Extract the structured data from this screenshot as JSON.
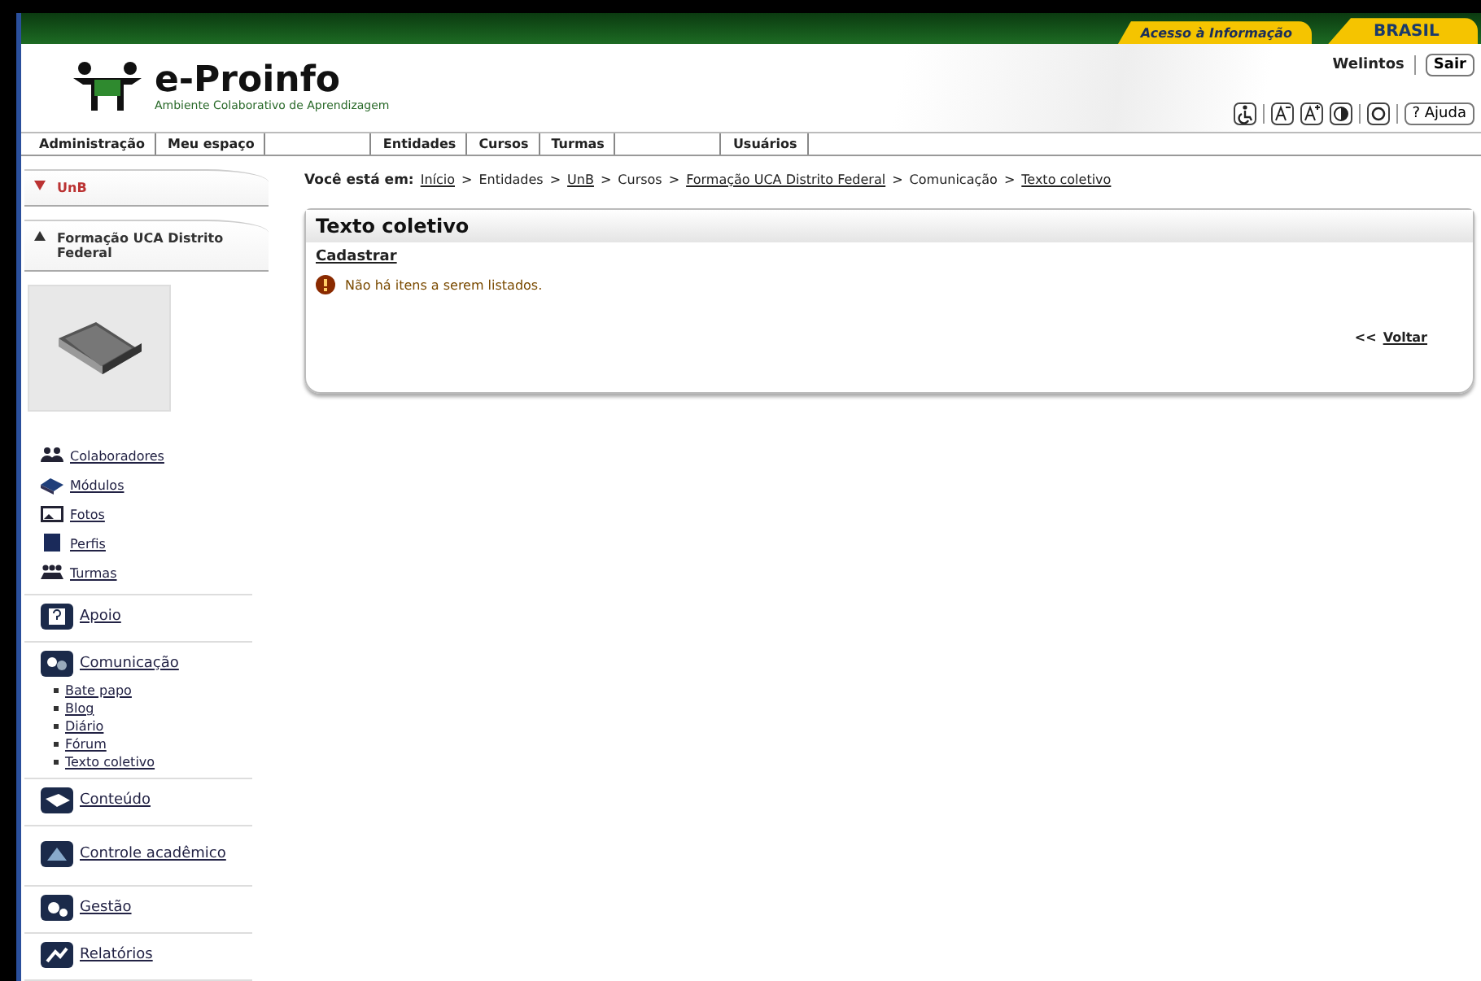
{
  "gov_bar": {
    "info_link": "Acesso à Informação",
    "brand": "BRASIL"
  },
  "header": {
    "logo_title": "e-Proinfo",
    "logo_subtitle": "Ambiente Colaborativo de Aprendizagem",
    "user": "Welintos",
    "logout": "Sair",
    "help": "? Ajuda"
  },
  "tabs": [
    {
      "kind": "tab",
      "label": "Administração"
    },
    {
      "kind": "tab",
      "label": "Meu espaço"
    },
    {
      "kind": "blank"
    },
    {
      "kind": "tab",
      "label": "Entidades"
    },
    {
      "kind": "tab",
      "label": "Cursos"
    },
    {
      "kind": "tab",
      "label": "Turmas"
    },
    {
      "kind": "blank"
    },
    {
      "kind": "tab",
      "label": "Usuários"
    }
  ],
  "sidebar": {
    "sections": [
      {
        "label": "UnB",
        "expanded": false
      },
      {
        "label": "Formação UCA Distrito Federal",
        "expanded": true
      }
    ],
    "groups": [
      {
        "items": [
          {
            "label": "Colaboradores"
          },
          {
            "label": "Módulos"
          },
          {
            "label": "Fotos"
          },
          {
            "label": "Perfis"
          },
          {
            "label": "Turmas"
          }
        ]
      },
      {
        "items": [
          {
            "label": "Apoio"
          }
        ]
      },
      {
        "items": [
          {
            "label": "Comunicação",
            "children": [
              {
                "label": "Bate papo"
              },
              {
                "label": "Blog"
              },
              {
                "label": "Diário"
              },
              {
                "label": "Fórum"
              },
              {
                "label": "Texto coletivo"
              }
            ]
          }
        ]
      },
      {
        "items": [
          {
            "label": "Conteúdo"
          }
        ]
      },
      {
        "items": [
          {
            "label": "Controle acadêmico"
          }
        ]
      },
      {
        "items": [
          {
            "label": "Gestão"
          }
        ]
      },
      {
        "items": [
          {
            "label": "Relatórios"
          }
        ]
      }
    ]
  },
  "breadcrumb": {
    "prefix": "Você está em:",
    "crumbs": [
      {
        "kind": "link",
        "text": "Início"
      },
      {
        "kind": "sep",
        "text": ">"
      },
      {
        "kind": "text",
        "text": "Entidades"
      },
      {
        "kind": "sep",
        "text": ">"
      },
      {
        "kind": "link",
        "text": "UnB"
      },
      {
        "kind": "sep",
        "text": ">"
      },
      {
        "kind": "text",
        "text": "Cursos"
      },
      {
        "kind": "sep",
        "text": ">"
      },
      {
        "kind": "link",
        "text": "Formação UCA Distrito Federal"
      },
      {
        "kind": "sep",
        "text": ">"
      },
      {
        "kind": "text",
        "text": "Comunicação"
      },
      {
        "kind": "sep",
        "text": ">"
      },
      {
        "kind": "link",
        "text": "Texto coletivo"
      }
    ]
  },
  "panel": {
    "title": "Texto coletivo",
    "action": "Cadastrar",
    "message": "Não há itens a serem listados.",
    "back_arrows": "<<",
    "back": "Voltar"
  }
}
